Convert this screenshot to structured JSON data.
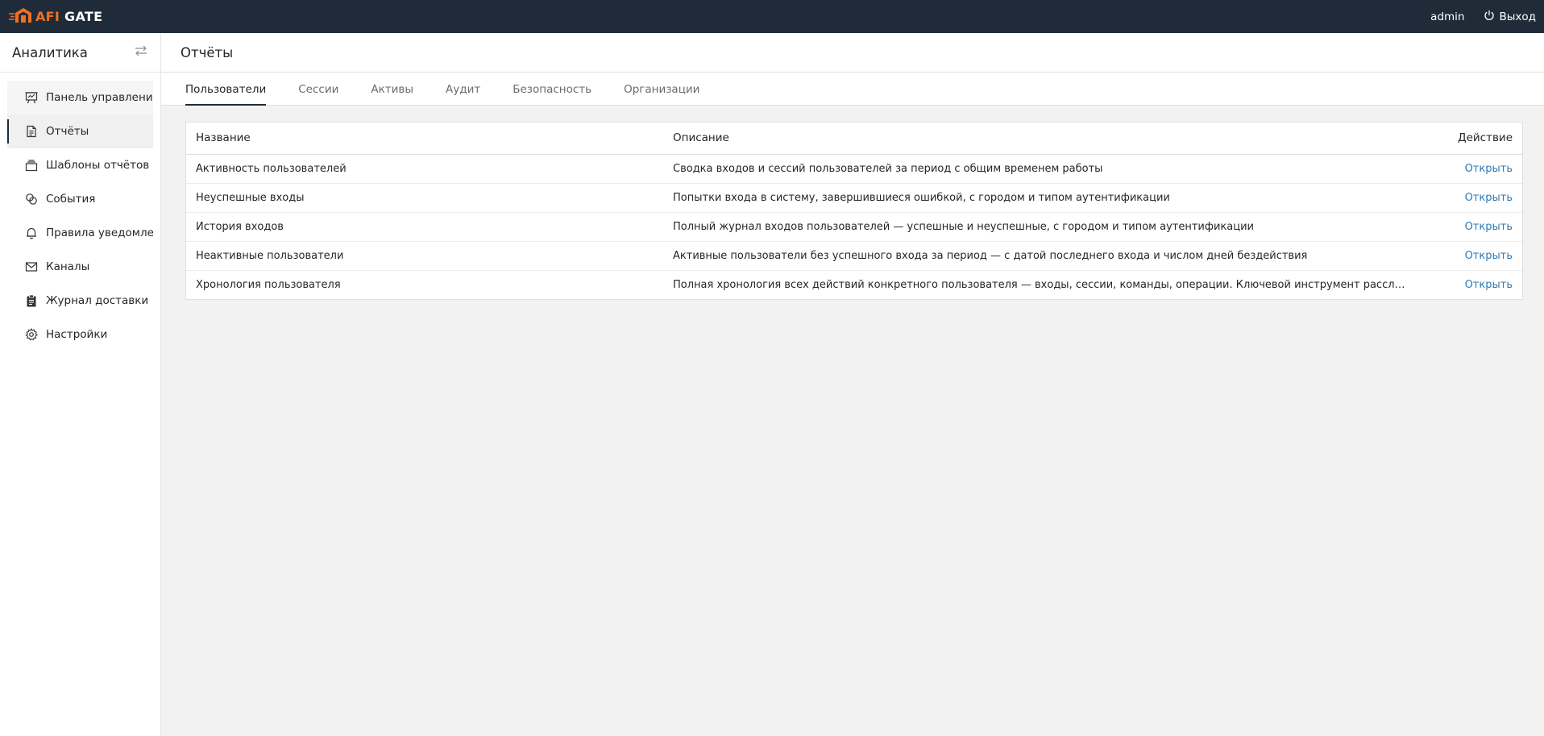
{
  "app": {
    "logo_afi": "AFI",
    "logo_gate": "GATE",
    "username": "admin",
    "logout_label": "Выход",
    "brand_color": "#f36f21",
    "topbar_color": "#1f2b38"
  },
  "sidebar": {
    "title": "Аналитика",
    "items": [
      {
        "label": "Панель управления",
        "icon": "dashboard-icon"
      },
      {
        "label": "Отчёты",
        "icon": "document-icon"
      },
      {
        "label": "Шаблоны отчётов",
        "icon": "layers-icon"
      },
      {
        "label": "События",
        "icon": "events-icon"
      },
      {
        "label": "Правила уведомлений",
        "icon": "bell-icon"
      },
      {
        "label": "Каналы",
        "icon": "mail-icon"
      },
      {
        "label": "Журнал доставки",
        "icon": "clipboard-icon"
      },
      {
        "label": "Настройки",
        "icon": "gear-icon"
      }
    ]
  },
  "main": {
    "title": "Отчёты",
    "tabs": [
      {
        "label": "Пользователи"
      },
      {
        "label": "Сессии"
      },
      {
        "label": "Активы"
      },
      {
        "label": "Аудит"
      },
      {
        "label": "Безопасность"
      },
      {
        "label": "Организации"
      }
    ],
    "table": {
      "headers": {
        "name": "Название",
        "description": "Описание",
        "action": "Действие"
      },
      "rows": [
        {
          "name": "Активность пользователей",
          "description": "Сводка входов и сессий пользователей за период с общим временем работы",
          "action": "Открыть"
        },
        {
          "name": "Неуспешные входы",
          "description": "Попытки входа в систему, завершившиеся ошибкой, с городом и типом аутентификации",
          "action": "Открыть"
        },
        {
          "name": "История входов",
          "description": "Полный журнал входов пользователей — успешные и неуспешные, с городом и типом аутентификации",
          "action": "Открыть"
        },
        {
          "name": "Неактивные пользователи",
          "description": "Активные пользователи без успешного входа за период — с датой последнего входа и числом дней бездействия",
          "action": "Открыть"
        },
        {
          "name": "Хронология пользователя",
          "description": "Полная хронология всех действий конкретного пользователя — входы, сессии, команды, операции. Ключевой инструмент расследования ин...",
          "action": "Открыть"
        }
      ]
    }
  }
}
